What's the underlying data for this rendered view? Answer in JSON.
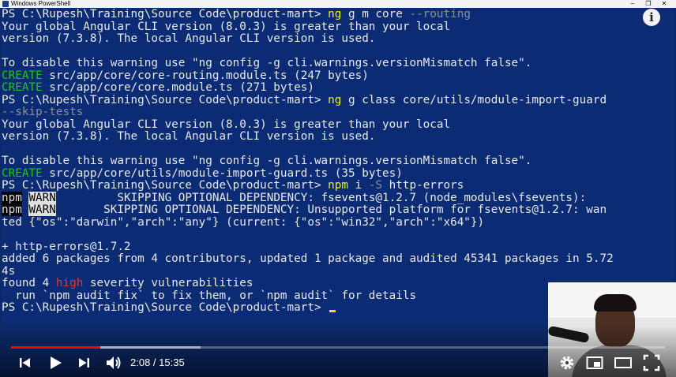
{
  "window": {
    "title": "Windows PowerShell",
    "controls": {
      "minimize": "–",
      "maximize": "❐",
      "close": "✕"
    }
  },
  "terminal": {
    "lines": [
      [
        {
          "t": "PS C:\\Rupesh\\Training\\Source Code\\product-mart> "
        },
        {
          "t": "ng",
          "c": "c-yellow"
        },
        {
          "t": " g m core "
        },
        {
          "t": "--routing",
          "c": "c-gray"
        }
      ],
      [
        {
          "t": "Your global Angular CLI version (8.0.3) is greater than your local"
        }
      ],
      [
        {
          "t": "version (7.3.8). The local Angular CLI version is used."
        }
      ],
      [
        {
          "t": ""
        }
      ],
      [
        {
          "t": "To disable this warning use \"ng config -g cli.warnings.versionMismatch false\"."
        }
      ],
      [
        {
          "t": "CREATE",
          "c": "c-green"
        },
        {
          "t": " src/app/core/core-routing.module.ts (247 bytes)"
        }
      ],
      [
        {
          "t": "CREATE",
          "c": "c-green"
        },
        {
          "t": " src/app/core/core.module.ts (271 bytes)"
        }
      ],
      [
        {
          "t": "PS C:\\Rupesh\\Training\\Source Code\\product-mart> "
        },
        {
          "t": "ng",
          "c": "c-yellow"
        },
        {
          "t": " g class core/utils/module-import-guard"
        }
      ],
      [
        {
          "t": "--skip-tests",
          "c": "c-gray"
        }
      ],
      [
        {
          "t": "Your global Angular CLI version (8.0.3) is greater than your local"
        }
      ],
      [
        {
          "t": "version (7.3.8). The local Angular CLI version is used."
        }
      ],
      [
        {
          "t": ""
        }
      ],
      [
        {
          "t": "To disable this warning use \"ng config -g cli.warnings.versionMismatch false\"."
        }
      ],
      [
        {
          "t": "CREATE",
          "c": "c-green"
        },
        {
          "t": " src/app/core/utils/module-import-guard.ts (35 bytes)"
        }
      ],
      [
        {
          "t": "PS C:\\Rupesh\\Training\\Source Code\\product-mart> "
        },
        {
          "t": "npm",
          "c": "c-yellow"
        },
        {
          "t": " i "
        },
        {
          "t": "-S",
          "c": "c-gray"
        },
        {
          "t": " http-errors"
        }
      ],
      [
        {
          "t": "npm",
          "c": "c-npm"
        },
        {
          "t": " "
        },
        {
          "t": "WARN",
          "c": "c-warn"
        },
        {
          "t": "         SKIPPING OPTIONAL DEPENDENCY: fsevents@1.2.7 (node_modules\\fsevents):"
        }
      ],
      [
        {
          "t": "npm",
          "c": "c-npm"
        },
        {
          "t": " "
        },
        {
          "t": "WARN",
          "c": "c-warn"
        },
        {
          "t": "       SKIPPING OPTIONAL DEPENDENCY: Unsupported platform for fsevents@1.2.7: wan"
        }
      ],
      [
        {
          "t": "ted {\"os\":\"darwin\",\"arch\":\"any\"} (current: {\"os\":\"win32\",\"arch\":\"x64\"})"
        }
      ],
      [
        {
          "t": ""
        }
      ],
      [
        {
          "t": "+ http-errors@1.7.2"
        }
      ],
      [
        {
          "t": "added 6 packages from 4 contributors, updated 1 package and audited 45341 packages in 5.72"
        }
      ],
      [
        {
          "t": "4s"
        }
      ],
      [
        {
          "t": "found 4 "
        },
        {
          "t": "high",
          "c": "c-red"
        },
        {
          "t": " severity vulnerabilities"
        }
      ],
      [
        {
          "t": "  run `npm audit fix` to fix them, or `npm audit` for details"
        }
      ],
      [
        {
          "t": "PS C:\\Rupesh\\Training\\Source Code\\product-mart> "
        },
        {
          "t": "",
          "cursor": true
        }
      ]
    ]
  },
  "info_button": {
    "glyph": "i"
  },
  "player": {
    "current_time": "2:08",
    "separator": " / ",
    "duration": "15:35",
    "played_fraction": 0.137,
    "buffered_fraction": 0.29,
    "icons": [
      "previous-icon",
      "play-icon",
      "next-icon",
      "volume-icon",
      "settings-icon",
      "miniplayer-icon",
      "theater-mode-icon",
      "fullscreen-icon"
    ],
    "accent_color": "#ff0000"
  }
}
